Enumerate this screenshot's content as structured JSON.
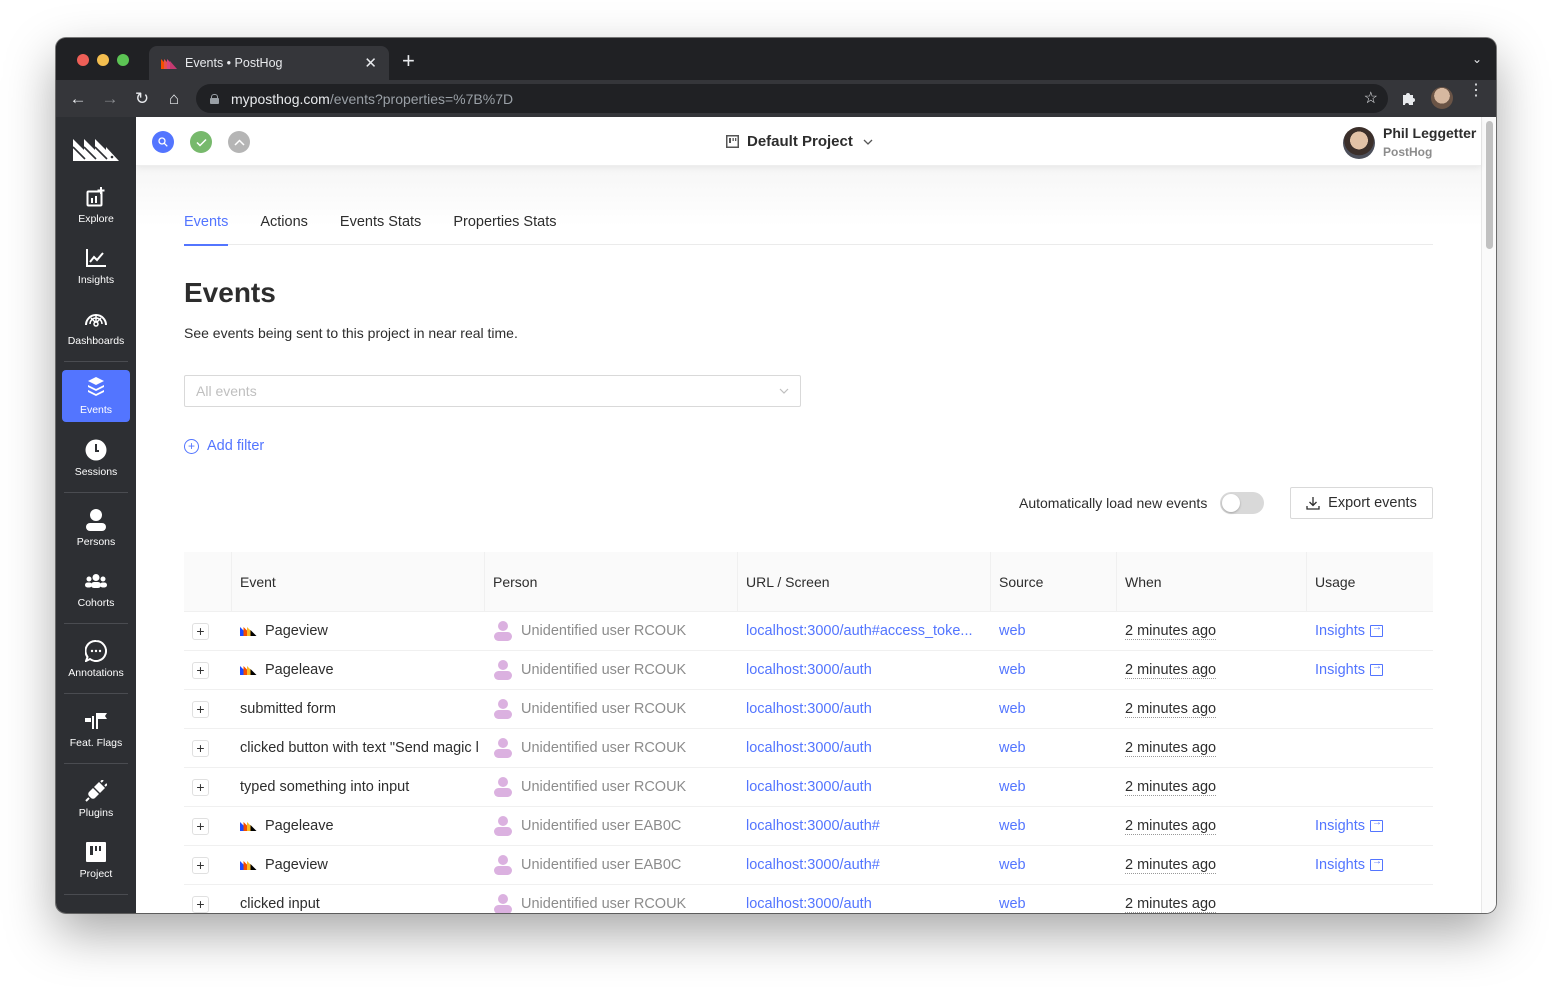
{
  "browser": {
    "tab_title": "Events • PostHog",
    "url_host": "myposthog.com",
    "url_path": "/events?properties=%7B%7D"
  },
  "sidebar": {
    "items": [
      {
        "label": "Explore",
        "icon": "explore-icon"
      },
      {
        "label": "Insights",
        "icon": "insights-icon"
      },
      {
        "label": "Dashboards",
        "icon": "dashboards-icon"
      },
      {
        "label": "Events",
        "icon": "events-icon",
        "active": true
      },
      {
        "label": "Sessions",
        "icon": "sessions-icon"
      },
      {
        "label": "Persons",
        "icon": "persons-icon"
      },
      {
        "label": "Cohorts",
        "icon": "cohorts-icon"
      },
      {
        "label": "Annotations",
        "icon": "annotations-icon"
      },
      {
        "label": "Feat. Flags",
        "icon": "feature-flags-icon"
      },
      {
        "label": "Plugins",
        "icon": "plugins-icon"
      },
      {
        "label": "Project",
        "icon": "project-icon"
      }
    ]
  },
  "topbar": {
    "project_name": "Default Project",
    "user_name": "Phil Leggetter",
    "user_org": "PostHog"
  },
  "page": {
    "tabs": [
      {
        "label": "Events",
        "active": true
      },
      {
        "label": "Actions"
      },
      {
        "label": "Events Stats"
      },
      {
        "label": "Properties Stats"
      }
    ],
    "title": "Events",
    "subtitle": "See events being sent to this project in near real time.",
    "event_select_placeholder": "All events",
    "add_filter_label": "Add filter",
    "auto_load_label": "Automatically load new events",
    "auto_load_enabled": false,
    "export_label": "Export events"
  },
  "table": {
    "columns": [
      "Event",
      "Person",
      "URL / Screen",
      "Source",
      "When",
      "Usage"
    ],
    "rows": [
      {
        "event": "Pageview",
        "posthog_icon": true,
        "person": "Unidentified user RCOUK",
        "url": "localhost:3000/auth#access_toke...",
        "source": "web",
        "when": "2 minutes ago",
        "usage": "Insights"
      },
      {
        "event": "Pageleave",
        "posthog_icon": true,
        "person": "Unidentified user RCOUK",
        "url": "localhost:3000/auth",
        "source": "web",
        "when": "2 minutes ago",
        "usage": "Insights"
      },
      {
        "event": "submitted form",
        "posthog_icon": false,
        "person": "Unidentified user RCOUK",
        "url": "localhost:3000/auth",
        "source": "web",
        "when": "2 minutes ago",
        "usage": ""
      },
      {
        "event": "clicked button with text \"Send magic l",
        "posthog_icon": false,
        "person": "Unidentified user RCOUK",
        "url": "localhost:3000/auth",
        "source": "web",
        "when": "2 minutes ago",
        "usage": ""
      },
      {
        "event": "typed something into input",
        "posthog_icon": false,
        "person": "Unidentified user RCOUK",
        "url": "localhost:3000/auth",
        "source": "web",
        "when": "2 minutes ago",
        "usage": ""
      },
      {
        "event": "Pageleave",
        "posthog_icon": true,
        "person": "Unidentified user EAB0C",
        "url": "localhost:3000/auth#",
        "source": "web",
        "when": "2 minutes ago",
        "usage": "Insights"
      },
      {
        "event": "Pageview",
        "posthog_icon": true,
        "person": "Unidentified user EAB0C",
        "url": "localhost:3000/auth#",
        "source": "web",
        "when": "2 minutes ago",
        "usage": "Insights"
      },
      {
        "event": "clicked input",
        "posthog_icon": false,
        "person": "Unidentified user RCOUK",
        "url": "localhost:3000/auth",
        "source": "web",
        "when": "2 minutes ago",
        "usage": ""
      }
    ]
  },
  "colors": {
    "accent": "#5375ff",
    "sidebar_bg": "#2d2f33",
    "person_icon": "#dbb1e0",
    "status_ok": "#77b96c"
  }
}
